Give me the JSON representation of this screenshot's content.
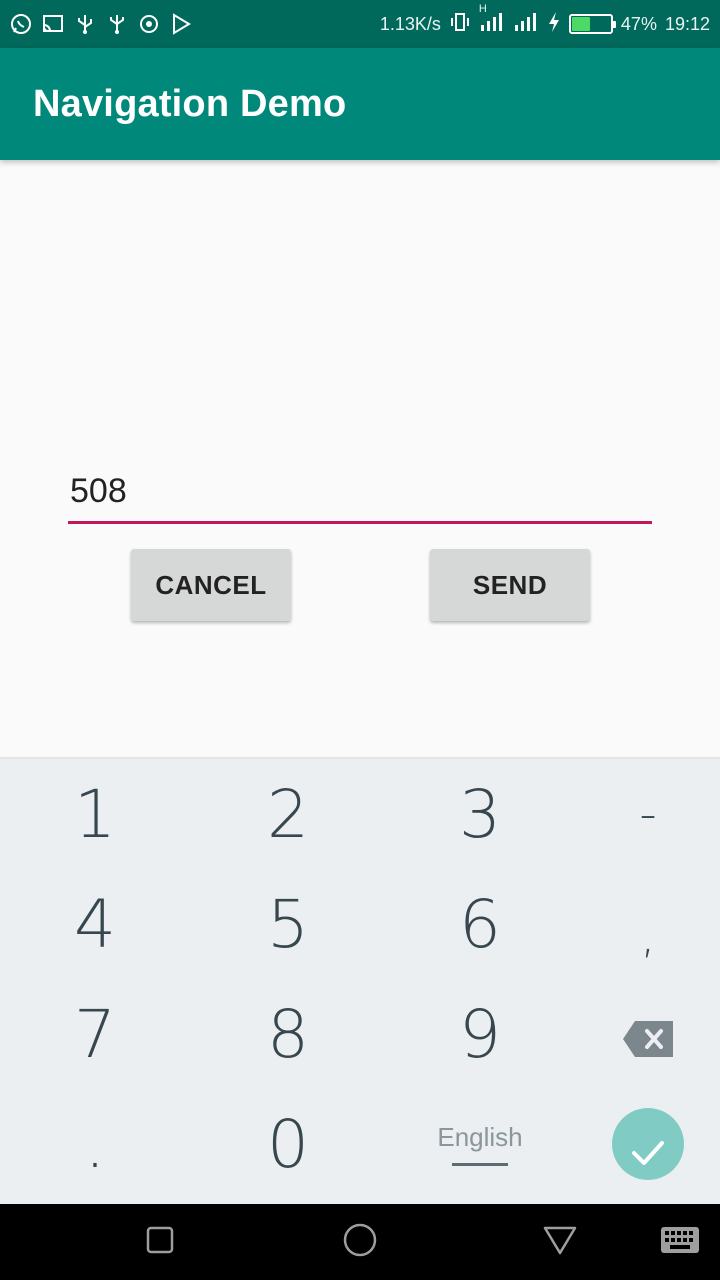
{
  "status_bar": {
    "left_icons": [
      "whatsapp-icon",
      "cast-icon",
      "usb-icon",
      "usb-icon",
      "sync-icon",
      "play-store-icon"
    ],
    "net_speed": "1.13K/s",
    "network_h": "H",
    "battery_percent": "47%",
    "battery_level": 0.47,
    "time": "19:12"
  },
  "app_bar": {
    "title": "Navigation Demo",
    "color": "#00897b"
  },
  "form": {
    "input_value": "508",
    "underline_color": "#c2185b",
    "cancel_label": "CANCEL",
    "send_label": "SEND"
  },
  "keyboard": {
    "row1": [
      "1",
      "2",
      "3",
      "-"
    ],
    "row2": [
      "4",
      "5",
      "6",
      ","
    ],
    "row3": [
      "7",
      "8",
      "9"
    ],
    "row4": [
      ".",
      "0"
    ],
    "language": "English",
    "backspace_icon": "backspace-icon",
    "done_icon": "check-icon",
    "done_color": "#80cbc4"
  },
  "nav_bar": {
    "icons": [
      "recent-apps-icon",
      "home-icon",
      "back-icon",
      "keyboard-icon"
    ]
  }
}
